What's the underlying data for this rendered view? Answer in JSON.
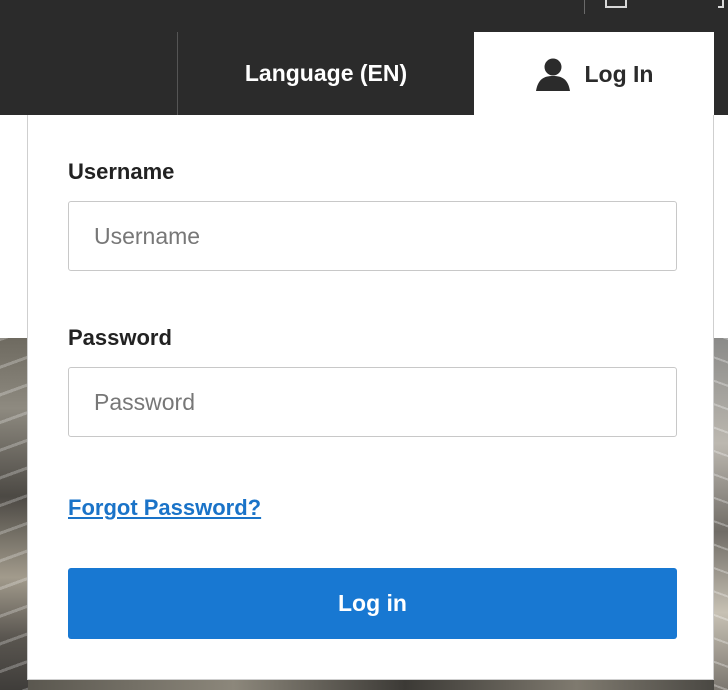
{
  "header": {
    "language_label": "Language (EN)",
    "login_tab_label": "Log In",
    "login_tab_icon": "user-icon",
    "bar_color": "#2b2b2b"
  },
  "login_form": {
    "username": {
      "label": "Username",
      "placeholder": "Username",
      "value": ""
    },
    "password": {
      "label": "Password",
      "placeholder": "Password",
      "value": ""
    },
    "forgot_password_label": "Forgot Password?",
    "submit_label": "Log in",
    "accent_color": "#1878d2",
    "link_color": "#1a73c8"
  }
}
